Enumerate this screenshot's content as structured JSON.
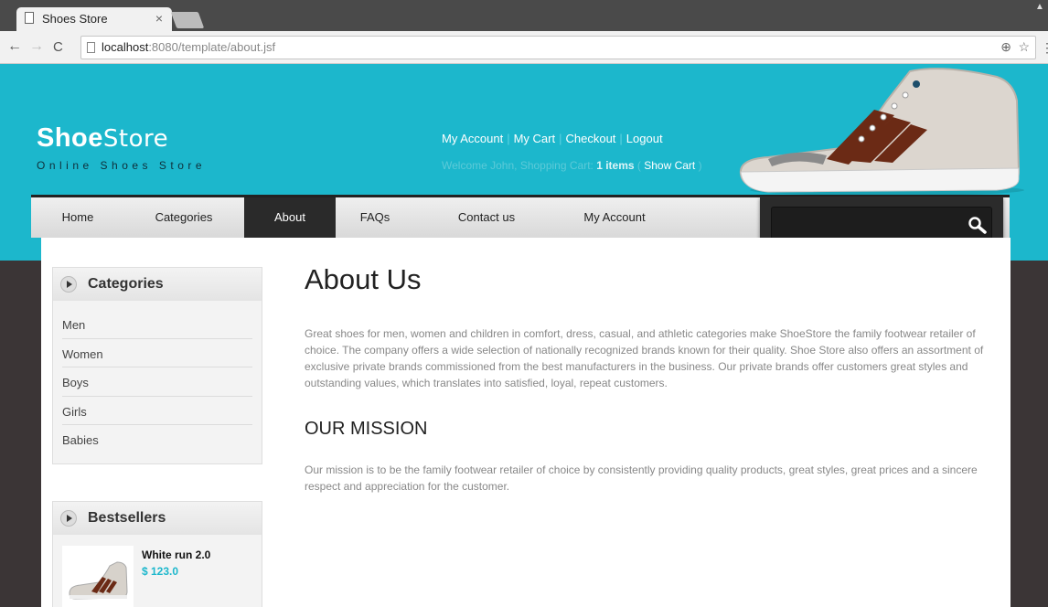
{
  "browser": {
    "tab_title": "Shoes Store",
    "tab_close": "×",
    "url_host": "localhost",
    "url_path": ":8080/template/about.jsf",
    "back": "←",
    "forward": "→",
    "reload": "C",
    "zoom_icon": "⊕",
    "star_icon": "☆",
    "menu_icon": "⋮"
  },
  "header": {
    "logo_bold": "Shoe",
    "logo_light": "Store",
    "tagline": "Online Shoes Store",
    "links": [
      "My Account",
      "My Cart",
      "Checkout",
      "Logout"
    ],
    "welcome_prefix": "Welcome John, Shopping Cart: ",
    "cart_items": "1 items",
    "paren_open": " ( ",
    "show_cart": "Show Cart",
    "paren_close": " )",
    "accent_color": "#1cb7cc"
  },
  "nav": {
    "items": [
      "Home",
      "Categories",
      "About",
      "FAQs",
      "Contact us",
      "My Account"
    ],
    "active": "About"
  },
  "sidebar": {
    "categories_title": "Categories",
    "categories": [
      "Men",
      "Women",
      "Boys",
      "Girls",
      "Babies"
    ],
    "bestsellers_title": "Bestsellers",
    "bestsellers": [
      {
        "name": "White run 2.0",
        "price": "$ 123.0"
      }
    ]
  },
  "main": {
    "title": "About Us",
    "about_text": "Great shoes for men, women and children in comfort, dress, casual, and athletic categories make ShoeStore the family footwear retailer of choice. The company offers a wide selection of nationally recognized brands known for their quality. Shoe Store also offers an assortment of exclusive private brands commissioned from the best manufacturers in the business. Our private brands offer customers great styles and outstanding values, which translates into satisfied, loyal, repeat customers.",
    "mission_title": "OUR MISSION",
    "mission_text": "Our mission is to be the family footwear retailer of choice by consistently providing quality products, great styles, great prices and a sincere respect and appreciation for the customer."
  }
}
